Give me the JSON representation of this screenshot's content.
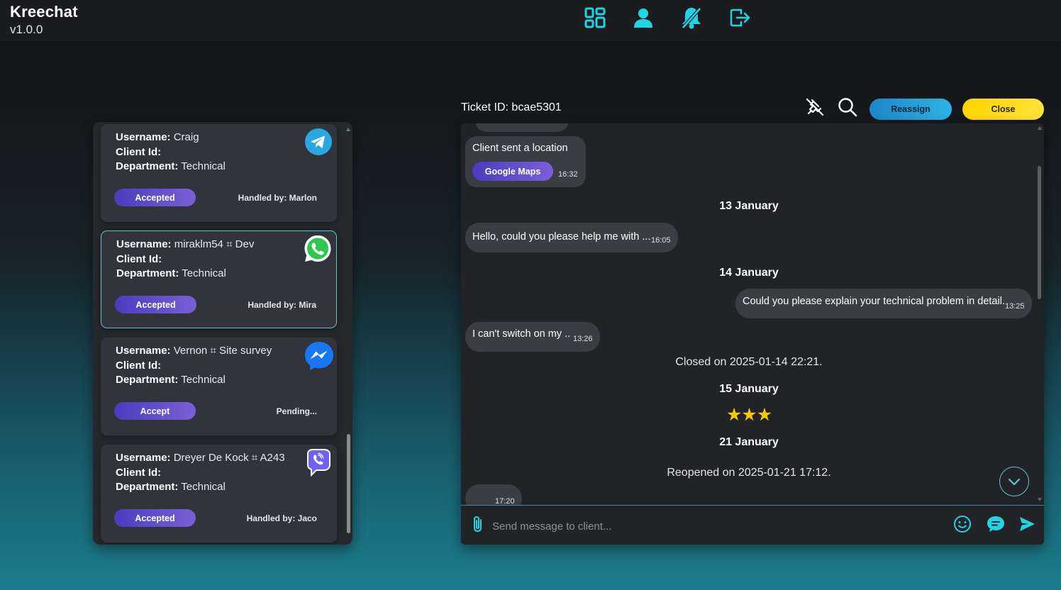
{
  "app": {
    "name": "Kreechat",
    "version": "v1.0.0"
  },
  "nav": {
    "icons": [
      "dashboard-icon",
      "user-icon",
      "bell-off-icon",
      "logout-icon"
    ],
    "accent": "#22d3e6"
  },
  "tickets": [
    {
      "username_label": "Username:",
      "username": "Craig",
      "client_label": "Client Id:",
      "client_id": "",
      "department_label": "Department:",
      "department": "Technical",
      "status": "Accepted",
      "handled": "Handled by: Marlon",
      "channel": "telegram-icon",
      "selected": false
    },
    {
      "username_label": "Username:",
      "username": "miraklm54 ⌗ Dev",
      "client_label": "Client Id:",
      "client_id": "",
      "department_label": "Department:",
      "department": "Technical",
      "status": "Accepted",
      "handled": "Handled by: Mira",
      "channel": "whatsapp-icon",
      "selected": true
    },
    {
      "username_label": "Username:",
      "username": "Vernon ⌗ Site survey",
      "client_label": "Client Id:",
      "client_id": "",
      "department_label": "Department:",
      "department": "Technical",
      "status": "Accept",
      "handled": "Pending...",
      "channel": "messenger-icon",
      "selected": false
    },
    {
      "username_label": "Username:",
      "username": "Dreyer De Kock ⌗ A243",
      "client_label": "Client Id:",
      "client_id": "",
      "department_label": "Department:",
      "department": "Technical",
      "status": "Accepted",
      "handled": "Handled by: Jaco",
      "channel": "viber-icon",
      "selected": false
    }
  ],
  "chat": {
    "ticket_id": "Ticket ID: bcae5301",
    "reassign_label": "Reassign",
    "close_label": "Close",
    "location_msg": {
      "text": "Client sent a location",
      "button": "Google Maps",
      "time": "16:32"
    },
    "date1": "13 January",
    "msg1": {
      "text": "Hello, could you please help me with ...",
      "time": "16:05"
    },
    "date2": "14 January",
    "msg2": {
      "text": "Could you please explain your technical problem in detail.",
      "time": "13:25"
    },
    "msg3": {
      "text": "I can't switch on my ..",
      "time": "13:26"
    },
    "closed_note": "Closed on 2025-01-14 22:21.",
    "date3": "15 January",
    "rating": 3,
    "rating_stars": "★★★",
    "date4": "21 January",
    "reopened_note": "Reopened on 2025-01-21 17:12.",
    "last_msg_time": "17:20",
    "composer_placeholder": "Send message to client..."
  }
}
